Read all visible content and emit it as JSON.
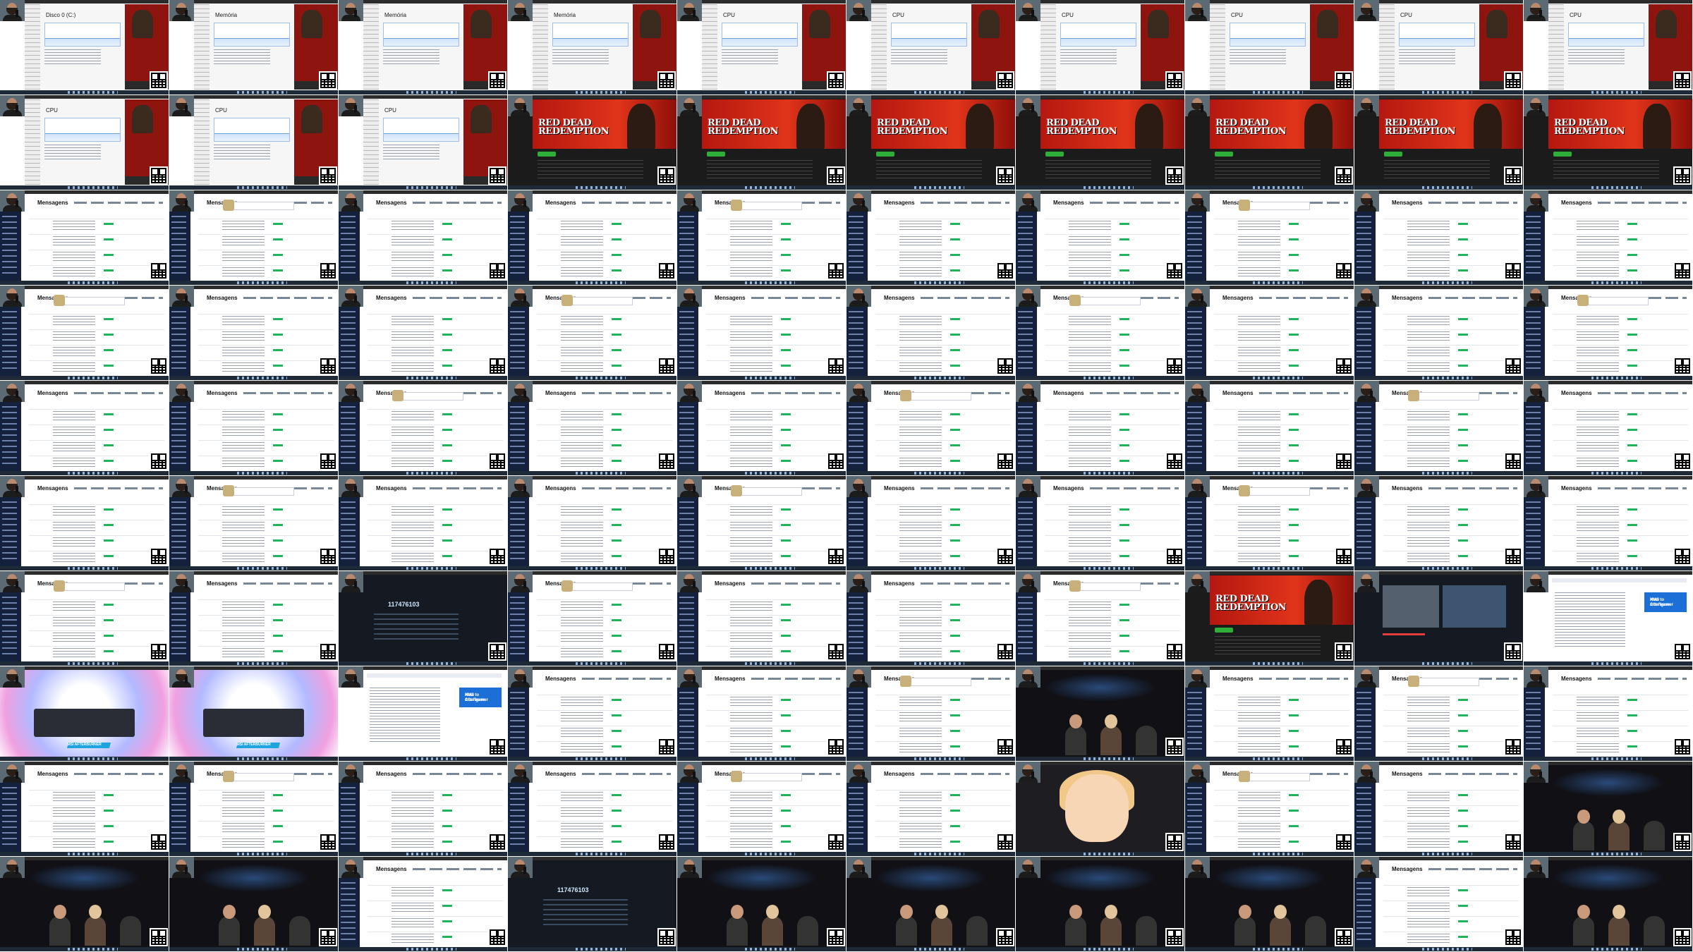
{
  "taskmgr": {
    "disk_title": "Disco 0 (C:)",
    "mem_title": "Memória",
    "cpu_title": "CPU"
  },
  "game": {
    "logo_line1": "RED DEAD",
    "logo_line2": "REDEMPTION"
  },
  "livepix": {
    "page_title": "Mensagens"
  },
  "web": {
    "how_to_title": "How to Configure",
    "how_to_sub": "XMS Afterburner"
  },
  "hardware": {
    "badge": "MSI AFTERBURNER"
  },
  "donation_page": {
    "amount": "117476103"
  },
  "colors": {
    "sidebar": "#13213d",
    "game_red": "#b5170f",
    "donation_green": "#22b35a",
    "taskbar": "#1e2a38"
  }
}
